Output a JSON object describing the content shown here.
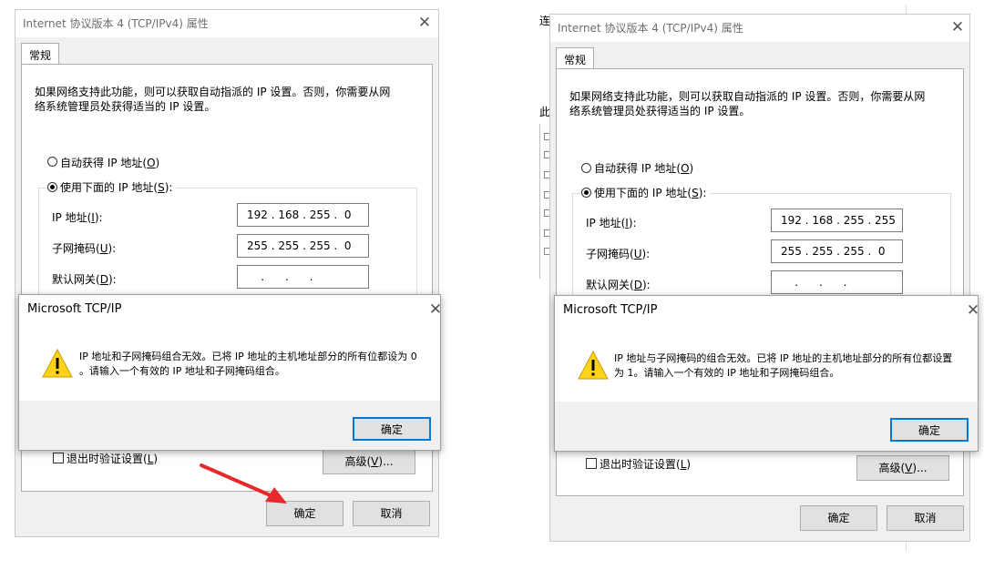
{
  "left": {
    "dialog": {
      "title": "Internet 协议版本 4 (TCP/IPv4) 属性",
      "tab": "常规",
      "description_line1": "如果网络支持此功能，则可以获取自动指派的 IP 设置。否则，你需要从网",
      "description_line2": "络系统管理员处获得适当的 IP 设置。",
      "auto_ip_label": "自动获得 IP 地址",
      "auto_ip_key": "O",
      "manual_ip_label": "使用下面的 IP 地址",
      "manual_ip_key": "S",
      "ip_label": "IP 地址",
      "ip_key": "I",
      "ip_value": "192 . 168 . 255 .  0",
      "mask_label": "子网掩码",
      "mask_key": "U",
      "mask_value": "255 . 255 . 255 .  0",
      "gateway_label": "默认网关",
      "gateway_key": "D",
      "gateway_value": "    .      .      .",
      "validate_label": "退出时验证设置",
      "validate_key": "L",
      "advanced_label": "高级",
      "advanced_key": "V",
      "ok_label": "确定",
      "cancel_label": "取消"
    },
    "message": {
      "title": "Microsoft TCP/IP",
      "line1": "IP 地址和子网掩码组合无效。已将 IP 地址的主机地址部分的所有位都设为 0",
      "line2": "。请输入一个有效的 IP 地址和子网掩码组合。",
      "ok_label": "确定"
    }
  },
  "right": {
    "background_fragments": [
      "连",
      "此"
    ],
    "dialog": {
      "title": "Internet 协议版本 4 (TCP/IPv4) 属性",
      "tab": "常规",
      "description_line1": "如果网络支持此功能，则可以获取自动指派的 IP 设置。否则，你需要从网",
      "description_line2": "络系统管理员处获得适当的 IP 设置。",
      "auto_ip_label": "自动获得 IP 地址",
      "auto_ip_key": "O",
      "manual_ip_label": "使用下面的 IP 地址",
      "manual_ip_key": "S",
      "ip_label": "IP 地址",
      "ip_key": "I",
      "ip_value": "192 . 168 . 255 . 255",
      "mask_label": "子网掩码",
      "mask_key": "U",
      "mask_value": "255 . 255 . 255 .  0",
      "gateway_label": "默认网关",
      "gateway_key": "D",
      "gateway_value": "    .      .      .",
      "validate_label": "退出时验证设置",
      "validate_key": "L",
      "advanced_label": "高级",
      "advanced_key": "V",
      "ok_label": "确定",
      "cancel_label": "取消"
    },
    "message": {
      "title": "Microsoft TCP/IP",
      "line1": "IP 地址与子网掩码的组合无效。已将 IP 地址的主机地址部分的所有位都设置",
      "line2": "为 1。请输入一个有效的 IP 地址和子网掩码组合。",
      "ok_label": "确定"
    }
  },
  "colors": {
    "dialog_bg": "#f0f0f0",
    "default_button_border": "#0078d7",
    "warning_yellow": "#ffd31a",
    "annotation_arrow": "#e8292b"
  },
  "icons": [
    "close-icon",
    "warning-icon",
    "red-arrow-annotation"
  ]
}
